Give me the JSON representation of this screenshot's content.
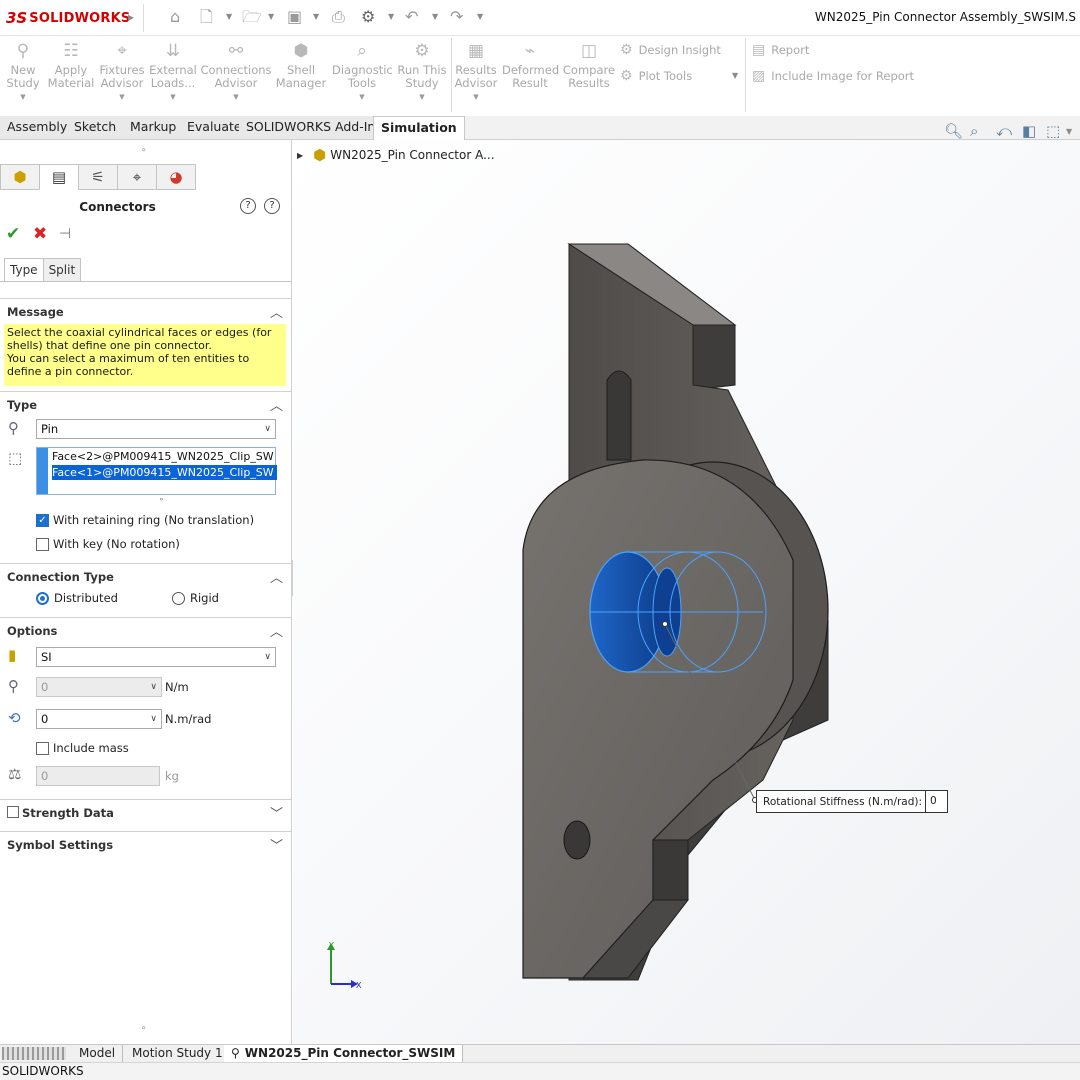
{
  "app": {
    "brand": "SOLIDWORKS",
    "brand_prefix": "3S",
    "doc_title": "WN2025_Pin Connector Assembly_SWSIM.S"
  },
  "toolbar": {
    "commands": [
      {
        "label": "New Study",
        "icon": "new-study-icon"
      },
      {
        "label": "Apply Material",
        "icon": "material-icon"
      },
      {
        "label": "Fixtures Advisor",
        "icon": "fixture-icon"
      },
      {
        "label": "External Loads...",
        "icon": "load-icon"
      },
      {
        "label": "Connections Advisor",
        "icon": "connection-icon"
      },
      {
        "label": "Shell Manager",
        "icon": "shell-icon"
      },
      {
        "label": "Diagnostic Tools",
        "icon": "diagnostic-icon"
      },
      {
        "label": "Run This Study",
        "icon": "run-icon"
      },
      {
        "label": "Results Advisor",
        "icon": "results-icon"
      },
      {
        "label": "Deformed Result",
        "icon": "deformed-icon"
      },
      {
        "label": "Compare Results",
        "icon": "compare-icon"
      }
    ],
    "design_insight": "Design Insight",
    "plot_tools": "Plot Tools",
    "report": "Report",
    "include_image": "Include Image for Report"
  },
  "tabs": [
    "Assembly",
    "Sketch",
    "Markup",
    "Evaluate",
    "SOLIDWORKS Add-Ins",
    "Simulation"
  ],
  "active_tab": "Simulation",
  "panel": {
    "title": "Connectors",
    "subtabs": [
      "Type",
      "Split"
    ],
    "message": {
      "header": "Message",
      "line1": "Select the coaxial cylindrical faces or edges (for shells) that define one pin connector.",
      "line2": "You can select a maximum of ten entities to define a pin connector."
    },
    "type": {
      "header": "Type",
      "selected": "Pin",
      "faces": [
        "Face<2>@PM009415_WN2025_Clip_SW",
        "Face<1>@PM009415_WN2025_Clip_SW"
      ],
      "retaining_ring": "With retaining ring (No translation)",
      "retaining_ring_checked": true,
      "with_key": "With key (No rotation)",
      "with_key_checked": false
    },
    "connection_type": {
      "header": "Connection Type",
      "distributed": "Distributed",
      "rigid": "Rigid",
      "selected": "Distributed"
    },
    "options": {
      "header": "Options",
      "units": "SI",
      "axial_value": "0",
      "axial_unit": "N/m",
      "rotational_value": "0",
      "rotational_unit": "N.m/rad",
      "include_mass": "Include mass",
      "mass_value": "0",
      "mass_unit": "kg"
    },
    "strength_data": "Strength Data",
    "symbol_settings": "Symbol Settings"
  },
  "viewport": {
    "tree_root": "WN2025_Pin Connector A...",
    "callout_label": "Rotational Stiffness (N.m/rad):",
    "callout_value": "0",
    "triad_y": "Y",
    "triad_x": "X"
  },
  "bottom_tabs": [
    "Model",
    "Motion Study 1",
    "WN2025_Pin Connector_SWSIM"
  ],
  "status": "SOLIDWORKS",
  "colors": {
    "brand_red": "#d40000",
    "selection_blue": "#0a64d6",
    "message_yellow": "#ffff8c",
    "part_gray": "#6f6c69"
  }
}
